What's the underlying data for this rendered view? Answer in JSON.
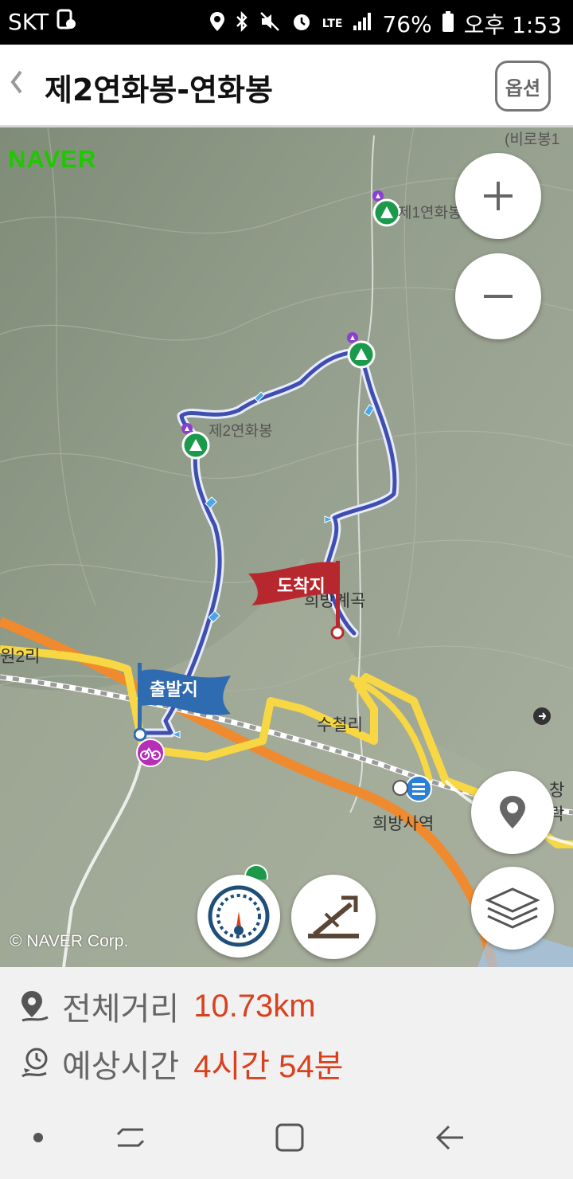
{
  "status_bar": {
    "carrier": "SKT",
    "network": "LTE",
    "battery": "76%",
    "time": "오후 1:53"
  },
  "header": {
    "title": "제2연화봉-연화봉",
    "option_label": "옵션"
  },
  "map": {
    "logo": "NAVER",
    "copyright": "© NAVER Corp.",
    "labels": {
      "peak1": "제1연화봉",
      "peak2": "제2연화봉",
      "top_right": "(비로봉1",
      "valley": "희방계곡",
      "village1": "수철리",
      "village2": "원2리",
      "station": "희방사역",
      "right_edge": "창락"
    },
    "start_flag": "출발지",
    "end_flag": "도착지"
  },
  "summary": {
    "distance_label": "전체거리",
    "distance_value": "10.73km",
    "time_label": "예상시간",
    "time_value": "4시간 54분"
  },
  "colors": {
    "route": "#3f4fb0",
    "start_flag": "#2e6bb0",
    "end_flag": "#b7282e",
    "accent_value": "#d9411e",
    "naver_green": "#1ec800"
  }
}
